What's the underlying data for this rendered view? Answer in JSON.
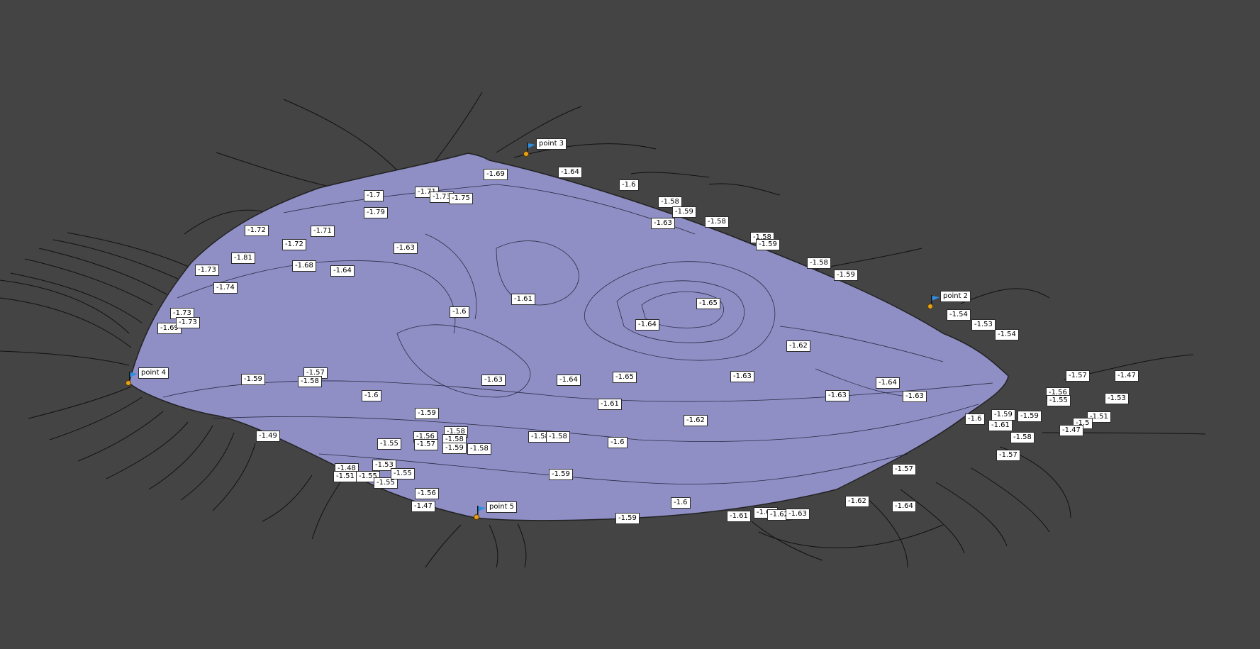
{
  "colors": {
    "background": "#444444",
    "surface": "#8f8fc6",
    "contour": "#111111",
    "label_bg": "#ffffff",
    "marker_flag": "#2e8fe0",
    "marker_dot": "#e8a21a"
  },
  "markers": [
    {
      "name": "point 3",
      "icon": "flag-icon"
    },
    {
      "name": "point 2",
      "icon": "flag-icon"
    },
    {
      "name": "point 4",
      "icon": "flag-icon"
    },
    {
      "name": "point 5",
      "icon": "flag-icon"
    }
  ],
  "contour_labels": [
    "-1.69",
    "-1.64",
    "-1.6",
    "-1.58",
    "-1.59",
    "-1.63",
    "-1.58",
    "-1.58",
    "-1.59",
    "-1.58",
    "-1.59",
    "-1.7",
    "-1.71",
    "-1.73",
    "-1.75",
    "-1.79",
    "-1.72",
    "-1.71",
    "-1.72",
    "-1.63",
    "-1.68",
    "-1.64",
    "-1.81",
    "-1.73",
    "-1.74",
    "-1.73",
    "-1.69",
    "-1.73",
    "-1.6",
    "-1.61",
    "-1.65",
    "-1.64",
    "-1.62",
    "-1.54",
    "-1.53",
    "-1.54",
    "-1.57",
    "-1.47",
    "-1.59",
    "-1.57",
    "-1.58",
    "-1.6",
    "-1.63",
    "-1.64",
    "-1.65",
    "-1.61",
    "-1.63",
    "-1.62",
    "-1.64",
    "-1.63",
    "-1.63",
    "-1.6",
    "-1.61",
    "-1.59",
    "-1.59",
    "-1.56",
    "-1.55",
    "-1.53",
    "-1.51",
    "-1.5",
    "-1.47",
    "-1.49",
    "-1.59",
    "-1.55",
    "-1.56",
    "-1.57",
    "-1.58",
    "-1.58",
    "-1.59",
    "-1.58",
    "-1.58",
    "-1.58",
    "-1.6",
    "-1.59",
    "-1.57",
    "-1.58",
    "-1.57",
    "-1.48",
    "-1.51",
    "-1.55",
    "-1.55",
    "-1.53",
    "-1.55",
    "-1.56",
    "-1.47",
    "-1.6",
    "-1.59",
    "-1.61",
    "-1.61",
    "-1.62",
    "-1.63",
    "-1.62",
    "-1.64"
  ]
}
